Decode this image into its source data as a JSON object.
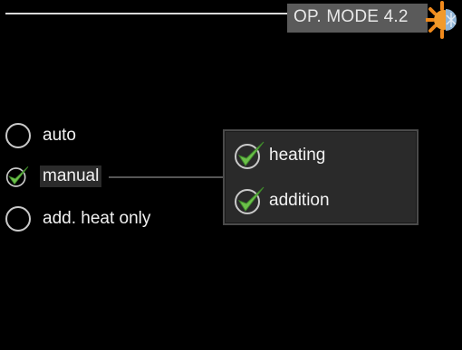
{
  "header": {
    "title": "OP. MODE 4.2",
    "icon": "sun-and-snowflake-icon"
  },
  "modes": [
    {
      "label": "auto",
      "checked": false
    },
    {
      "label": "manual",
      "checked": true
    },
    {
      "label": "add. heat only",
      "checked": false
    }
  ],
  "manual_options": [
    {
      "label": "heating",
      "checked": true
    },
    {
      "label": "addition",
      "checked": true
    }
  ],
  "colors": {
    "check_green": "#6cc04a",
    "background": "#000000",
    "header_bg": "#5a5a5a"
  }
}
